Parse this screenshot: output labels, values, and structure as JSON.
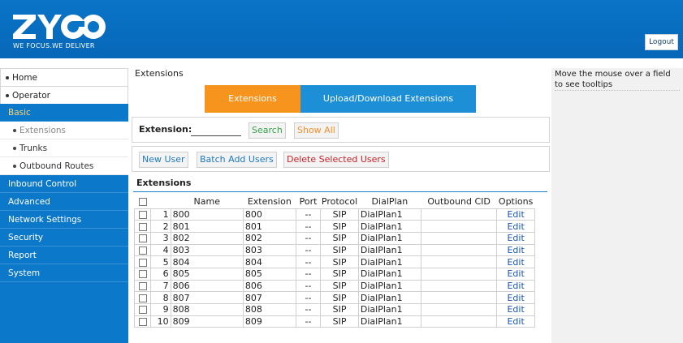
{
  "header": {
    "logo": "ZYCOO",
    "slogan": "WE FOCUS.WE DELIVER",
    "logout_label": "Logout"
  },
  "sidebar": {
    "home": "Home",
    "operator": "Operator",
    "basic": "Basic",
    "extensions": "Extensions",
    "trunks": "Trunks",
    "outbound_routes": "Outbound Routes",
    "inbound_control": "Inbound Control",
    "advanced": "Advanced",
    "network_settings": "Network Settings",
    "security": "Security",
    "report": "Report",
    "system": "System"
  },
  "main": {
    "page_title": "Extensions",
    "tabs": [
      {
        "label": "Extensions",
        "active": true
      },
      {
        "label": "Upload/Download Extensions",
        "active": false
      }
    ],
    "filter": {
      "label": "Extension:",
      "value": "",
      "search_label": "Search",
      "show_all_label": "Show All"
    },
    "actions": {
      "new_user": "New User",
      "batch_add": "Batch Add Users",
      "delete_selected": "Delete Selected Users"
    },
    "list_title": "Extensions",
    "table": {
      "headers": [
        "",
        "",
        "Name",
        "Extension",
        "Port",
        "Protocol",
        "DialPlan",
        "Outbound CID",
        "Options"
      ],
      "rows": [
        {
          "num": "1",
          "name": "800",
          "extension": "800",
          "port": "--",
          "protocol": "SIP",
          "dialplan": "DialPlan1",
          "cid": "",
          "option": "Edit"
        },
        {
          "num": "2",
          "name": "801",
          "extension": "801",
          "port": "--",
          "protocol": "SIP",
          "dialplan": "DialPlan1",
          "cid": "",
          "option": "Edit"
        },
        {
          "num": "3",
          "name": "802",
          "extension": "802",
          "port": "--",
          "protocol": "SIP",
          "dialplan": "DialPlan1",
          "cid": "",
          "option": "Edit"
        },
        {
          "num": "4",
          "name": "803",
          "extension": "803",
          "port": "--",
          "protocol": "SIP",
          "dialplan": "DialPlan1",
          "cid": "",
          "option": "Edit"
        },
        {
          "num": "5",
          "name": "804",
          "extension": "804",
          "port": "--",
          "protocol": "SIP",
          "dialplan": "DialPlan1",
          "cid": "",
          "option": "Edit"
        },
        {
          "num": "6",
          "name": "805",
          "extension": "805",
          "port": "--",
          "protocol": "SIP",
          "dialplan": "DialPlan1",
          "cid": "",
          "option": "Edit"
        },
        {
          "num": "7",
          "name": "806",
          "extension": "806",
          "port": "--",
          "protocol": "SIP",
          "dialplan": "DialPlan1",
          "cid": "",
          "option": "Edit"
        },
        {
          "num": "8",
          "name": "807",
          "extension": "807",
          "port": "--",
          "protocol": "SIP",
          "dialplan": "DialPlan1",
          "cid": "",
          "option": "Edit"
        },
        {
          "num": "9",
          "name": "808",
          "extension": "808",
          "port": "--",
          "protocol": "SIP",
          "dialplan": "DialPlan1",
          "cid": "",
          "option": "Edit"
        },
        {
          "num": "10",
          "name": "809",
          "extension": "809",
          "port": "--",
          "protocol": "SIP",
          "dialplan": "DialPlan1",
          "cid": "",
          "option": "Edit"
        }
      ]
    }
  },
  "tooltip": {
    "text": "Move the mouse over a field to see tooltips"
  },
  "colors": {
    "header_blue": "#0a74c7",
    "sidebar_blue": "#0b78c9",
    "tab_active": "#f6941d",
    "tab_inactive": "#1c8fd7",
    "active_nav": "#ffd36a"
  }
}
